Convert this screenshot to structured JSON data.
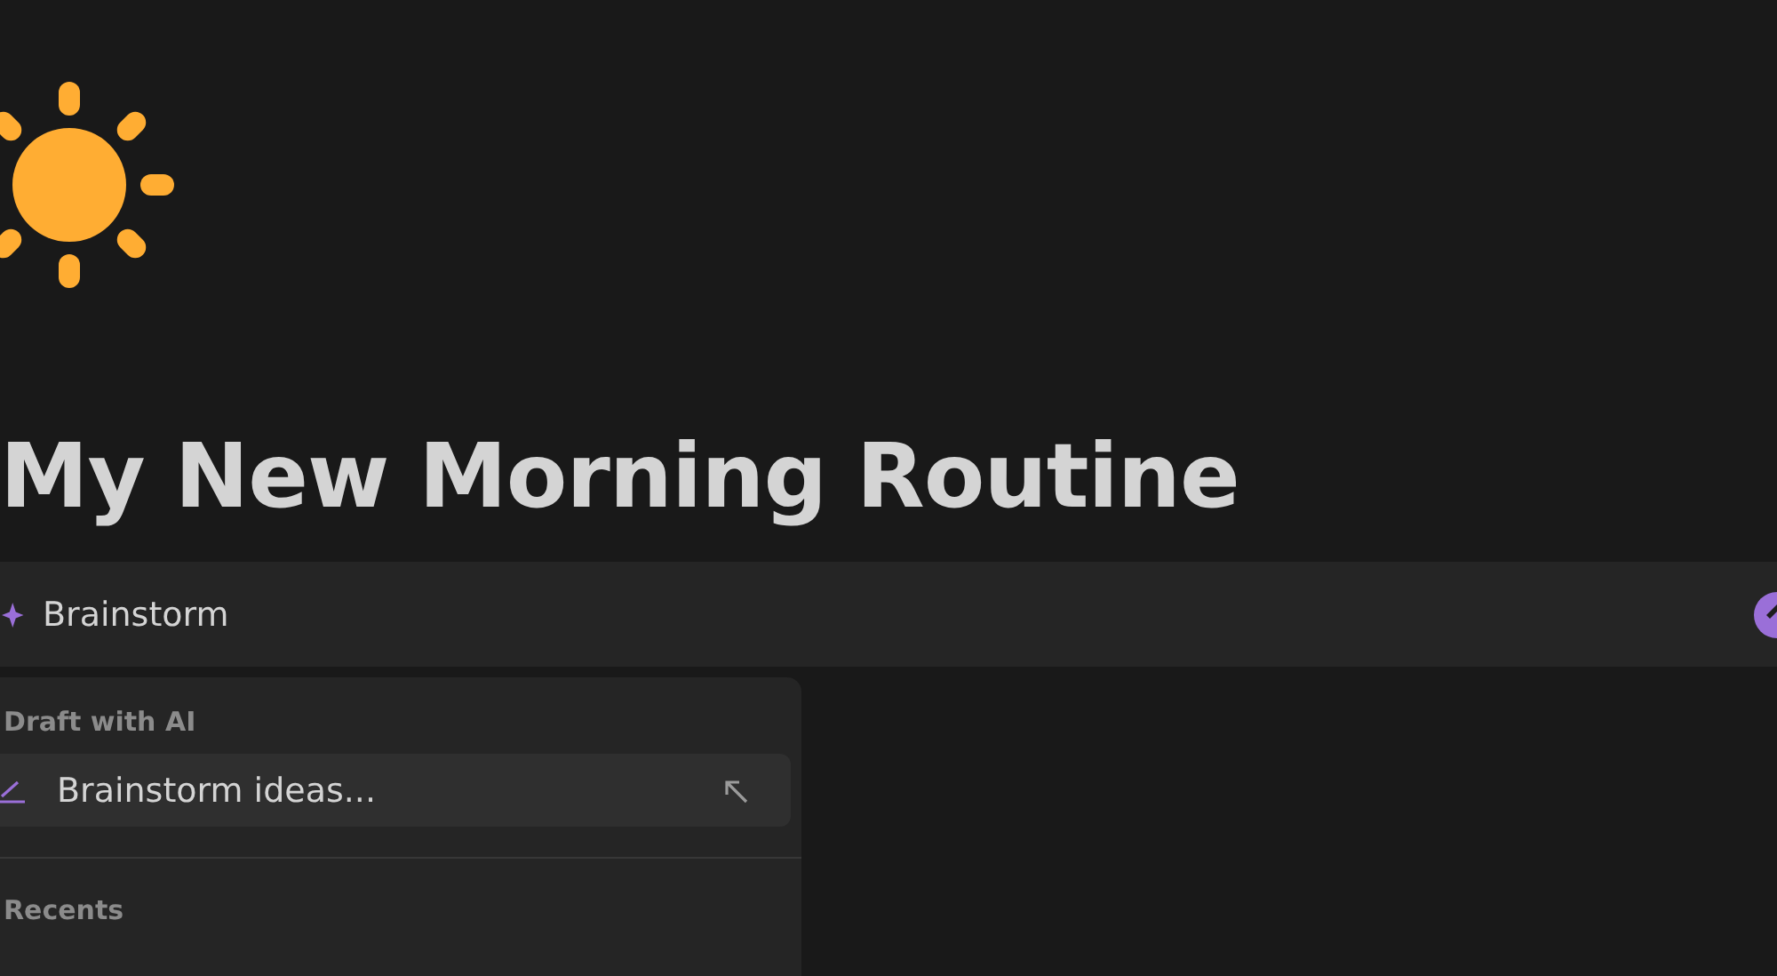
{
  "page": {
    "title": "My New Morning Routine"
  },
  "ai_prompt": {
    "placeholder": "Brainstorm"
  },
  "menu": {
    "sections": [
      {
        "heading": "Draft with AI",
        "items": [
          {
            "label": "Brainstorm ideas...",
            "selected": true
          }
        ]
      },
      {
        "heading": "Recents"
      }
    ]
  }
}
